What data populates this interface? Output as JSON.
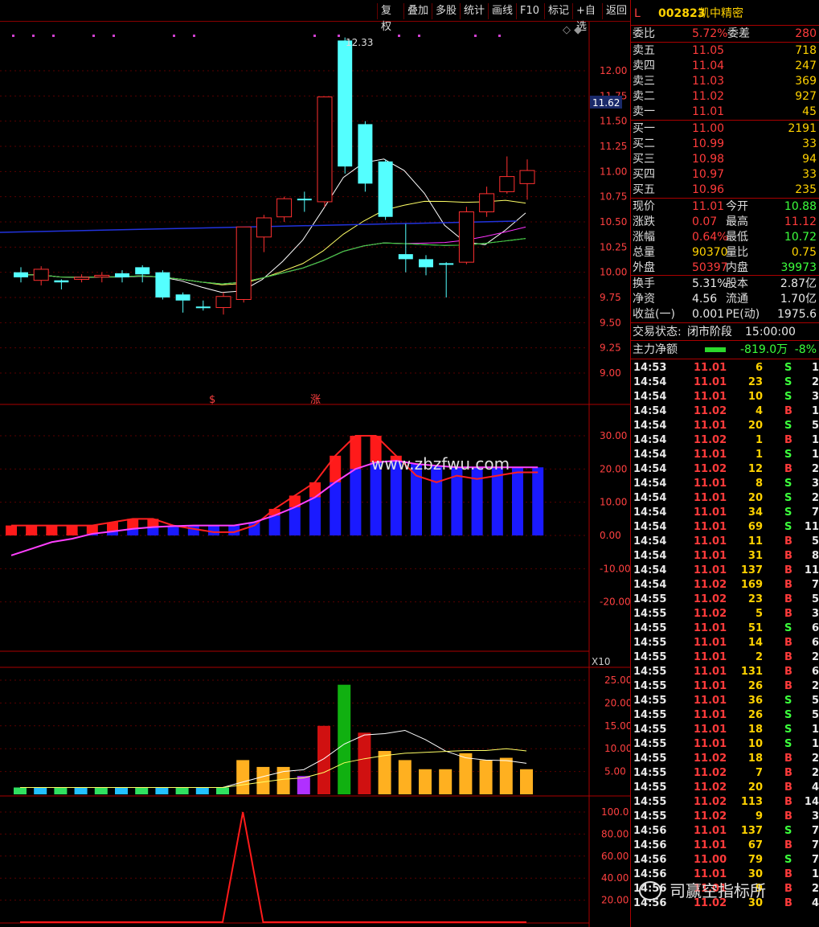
{
  "toolbar": {
    "buttons": [
      "复权",
      "叠加",
      "多股",
      "统计",
      "画线",
      "F10",
      "标记",
      "+自选",
      "返回"
    ]
  },
  "price_axis": {
    "labels": [
      "12.00",
      "11.75",
      "11.50",
      "11.25",
      "11.00",
      "10.75",
      "10.50",
      "10.25",
      "10.00",
      "9.75",
      "9.50",
      "9.25",
      "9.00"
    ],
    "current": "11.62",
    "high_label": "12.33",
    "markers": [
      "$",
      "涨"
    ]
  },
  "macd_axis": {
    "labels": [
      "30.00",
      "20.00",
      "10.00",
      "0.00",
      "-10.00",
      "-20.00"
    ]
  },
  "vol_axis": {
    "labels": [
      "25.00",
      "20.00",
      "15.00",
      "10.00",
      "5.00"
    ],
    "unit": "X10"
  },
  "ind_axis": {
    "labels": [
      "100.0",
      "80.00",
      "60.00",
      "40.00",
      "20.00"
    ]
  },
  "watermark": "www.zbzfwu.com",
  "stock": {
    "market": "L",
    "code": "002823",
    "name": "凯中精密"
  },
  "ratio": {
    "label": "委比",
    "value": "5.72%",
    "diff_label": "委差",
    "diff": "280"
  },
  "asks": [
    {
      "label": "卖五",
      "price": "11.05",
      "vol": "718"
    },
    {
      "label": "卖四",
      "price": "11.04",
      "vol": "247"
    },
    {
      "label": "卖三",
      "price": "11.03",
      "vol": "369"
    },
    {
      "label": "卖二",
      "price": "11.02",
      "vol": "927"
    },
    {
      "label": "卖一",
      "price": "11.01",
      "vol": "45"
    }
  ],
  "bids": [
    {
      "label": "买一",
      "price": "11.00",
      "vol": "2191"
    },
    {
      "label": "买二",
      "price": "10.99",
      "vol": "33"
    },
    {
      "label": "买三",
      "price": "10.98",
      "vol": "94"
    },
    {
      "label": "买四",
      "price": "10.97",
      "vol": "33"
    },
    {
      "label": "买五",
      "price": "10.96",
      "vol": "235"
    }
  ],
  "quote": [
    {
      "l1": "现价",
      "v1": "11.01",
      "l2": "今开",
      "v2": "10.88"
    },
    {
      "l1": "涨跌",
      "v1": "0.07",
      "l2": "最高",
      "v2": "11.12"
    },
    {
      "l1": "涨幅",
      "v1": "0.64%",
      "l2": "最低",
      "v2": "10.72"
    },
    {
      "l1": "总量",
      "v1": "90370",
      "l2": "量比",
      "v2": "0.75"
    },
    {
      "l1": "外盘",
      "v1": "50397",
      "l2": "内盘",
      "v2": "39973"
    }
  ],
  "fin": [
    {
      "l1": "换手",
      "v1": "5.31%",
      "l2": "股本",
      "v2": "2.87亿"
    },
    {
      "l1": "净资",
      "v1": "4.56",
      "l2": "流通",
      "v2": "1.70亿"
    },
    {
      "l1": "收益(一)",
      "v1": "0.001",
      "l2": "PE(动)",
      "v2": "1975.6"
    }
  ],
  "status": {
    "label": "交易状态:",
    "value": "闭市阶段",
    "time": "15:00:00"
  },
  "mainforce": {
    "label": "主力净额",
    "value": "-819.0万",
    "pct": "-8%"
  },
  "ticks": [
    [
      "14:53",
      "11.01",
      "6",
      "S",
      "1"
    ],
    [
      "14:54",
      "11.01",
      "23",
      "S",
      "2"
    ],
    [
      "14:54",
      "11.01",
      "10",
      "S",
      "3"
    ],
    [
      "14:54",
      "11.02",
      "4",
      "B",
      "1"
    ],
    [
      "14:54",
      "11.01",
      "20",
      "S",
      "5"
    ],
    [
      "14:54",
      "11.02",
      "1",
      "B",
      "1"
    ],
    [
      "14:54",
      "11.01",
      "1",
      "S",
      "1"
    ],
    [
      "14:54",
      "11.02",
      "12",
      "B",
      "2"
    ],
    [
      "14:54",
      "11.01",
      "8",
      "S",
      "3"
    ],
    [
      "14:54",
      "11.01",
      "20",
      "S",
      "2"
    ],
    [
      "14:54",
      "11.01",
      "34",
      "S",
      "7"
    ],
    [
      "14:54",
      "11.01",
      "69",
      "S",
      "11"
    ],
    [
      "14:54",
      "11.01",
      "11",
      "B",
      "5"
    ],
    [
      "14:54",
      "11.01",
      "31",
      "B",
      "8"
    ],
    [
      "14:54",
      "11.01",
      "137",
      "B",
      "11"
    ],
    [
      "14:54",
      "11.02",
      "169",
      "B",
      "7"
    ],
    [
      "14:55",
      "11.02",
      "23",
      "B",
      "5"
    ],
    [
      "14:55",
      "11.02",
      "5",
      "B",
      "3"
    ],
    [
      "14:55",
      "11.01",
      "51",
      "S",
      "6"
    ],
    [
      "14:55",
      "11.01",
      "14",
      "B",
      "6"
    ],
    [
      "14:55",
      "11.01",
      "2",
      "B",
      "2"
    ],
    [
      "14:55",
      "11.01",
      "131",
      "B",
      "6"
    ],
    [
      "14:55",
      "11.01",
      "26",
      "B",
      "2"
    ],
    [
      "14:55",
      "11.01",
      "36",
      "S",
      "5"
    ],
    [
      "14:55",
      "11.01",
      "26",
      "S",
      "5"
    ],
    [
      "14:55",
      "11.01",
      "18",
      "S",
      "1"
    ],
    [
      "14:55",
      "11.01",
      "10",
      "S",
      "1"
    ],
    [
      "14:55",
      "11.02",
      "18",
      "B",
      "2"
    ],
    [
      "14:55",
      "11.02",
      "7",
      "B",
      "2"
    ],
    [
      "14:55",
      "11.02",
      "20",
      "B",
      "4"
    ],
    [
      "14:55",
      "11.02",
      "113",
      "B",
      "14"
    ],
    [
      "14:55",
      "11.02",
      "9",
      "B",
      "3"
    ],
    [
      "14:56",
      "11.01",
      "137",
      "S",
      "7"
    ],
    [
      "14:56",
      "11.01",
      "67",
      "B",
      "7"
    ],
    [
      "14:56",
      "11.00",
      "79",
      "S",
      "7"
    ],
    [
      "14:56",
      "11.01",
      "30",
      "B",
      "1"
    ],
    [
      "14:56",
      "11.01",
      "9",
      "B",
      "2"
    ],
    [
      "14:56",
      "11.02",
      "30",
      "B",
      "4"
    ]
  ],
  "chart_data": [
    {
      "type": "candlestick",
      "ylim": [
        9.0,
        12.33
      ],
      "candles": [
        {
          "o": 10.0,
          "c": 9.95,
          "h": 10.05,
          "l": 9.9
        },
        {
          "o": 9.92,
          "c": 10.03,
          "h": 10.06,
          "l": 9.87
        },
        {
          "o": 9.92,
          "c": 9.9,
          "h": 9.93,
          "l": 9.83
        },
        {
          "o": 9.93,
          "c": 9.95,
          "h": 9.98,
          "l": 9.9
        },
        {
          "o": 9.96,
          "c": 9.97,
          "h": 10.0,
          "l": 9.9
        },
        {
          "o": 9.99,
          "c": 9.95,
          "h": 10.02,
          "l": 9.9
        },
        {
          "o": 10.05,
          "c": 9.98,
          "h": 10.07,
          "l": 9.9
        },
        {
          "o": 10.0,
          "c": 9.75,
          "h": 10.02,
          "l": 9.73
        },
        {
          "o": 9.78,
          "c": 9.72,
          "h": 9.8,
          "l": 9.6
        },
        {
          "o": 9.66,
          "c": 9.65,
          "h": 9.72,
          "l": 9.62
        },
        {
          "o": 9.65,
          "c": 9.76,
          "h": 9.8,
          "l": 9.58
        },
        {
          "o": 9.73,
          "c": 10.45,
          "h": 10.45,
          "l": 9.7
        },
        {
          "o": 10.35,
          "c": 10.54,
          "h": 10.57,
          "l": 10.2
        },
        {
          "o": 10.55,
          "c": 10.73,
          "h": 10.75,
          "l": 10.5
        },
        {
          "o": 10.73,
          "c": 10.72,
          "h": 10.8,
          "l": 10.6
        },
        {
          "o": 10.7,
          "c": 11.74,
          "h": 11.74,
          "l": 10.65
        },
        {
          "o": 12.3,
          "c": 11.05,
          "h": 12.33,
          "l": 10.98
        },
        {
          "o": 11.47,
          "c": 10.88,
          "h": 11.5,
          "l": 10.8
        },
        {
          "o": 11.1,
          "c": 10.55,
          "h": 11.12,
          "l": 10.52
        },
        {
          "o": 10.18,
          "c": 10.13,
          "h": 10.48,
          "l": 10.0
        },
        {
          "o": 10.13,
          "c": 10.05,
          "h": 10.17,
          "l": 9.97
        },
        {
          "o": 10.09,
          "c": 10.08,
          "h": 10.1,
          "l": 9.75
        },
        {
          "o": 10.1,
          "c": 10.6,
          "h": 10.65,
          "l": 10.08
        },
        {
          "o": 10.6,
          "c": 10.78,
          "h": 10.85,
          "l": 10.55
        },
        {
          "o": 10.8,
          "c": 10.95,
          "h": 11.15,
          "l": 10.78
        },
        {
          "o": 10.88,
          "c": 11.01,
          "h": 11.12,
          "l": 10.72
        }
      ]
    },
    {
      "type": "bar",
      "ylim": [
        -25,
        34
      ],
      "values": [
        3,
        3,
        3,
        3,
        3,
        4,
        5,
        5,
        3,
        2,
        1,
        1,
        3,
        8,
        12,
        16,
        24,
        30,
        30,
        24,
        18,
        16,
        18,
        17,
        18,
        19,
        19
      ],
      "signal": [
        -6,
        -4,
        -2,
        -1,
        0.5,
        1.2,
        2,
        2.5,
        2.8,
        3,
        3,
        3,
        4,
        6,
        8.5,
        11.5,
        16,
        20,
        22,
        22.5,
        21.5,
        21,
        20.5,
        20.5,
        20.5,
        20.5,
        20.5
      ]
    },
    {
      "type": "bar",
      "ylim": [
        0,
        25
      ],
      "values": [
        1.5,
        1.5,
        1.5,
        1.5,
        1.5,
        1.5,
        1.5,
        1.5,
        1.5,
        1.5,
        1.5,
        7.5,
        6,
        6,
        4,
        15,
        24,
        13.5,
        9.5,
        7.5,
        5.5,
        5.5,
        9,
        7.5,
        8,
        5.5
      ]
    },
    {
      "type": "line",
      "ylim": [
        0,
        100
      ],
      "values": [
        0,
        0,
        0,
        0,
        0,
        0,
        0,
        0,
        0,
        0,
        0,
        100,
        0,
        0,
        0,
        0,
        0,
        0,
        0,
        0,
        0,
        0,
        0,
        0,
        0,
        0
      ]
    }
  ]
}
